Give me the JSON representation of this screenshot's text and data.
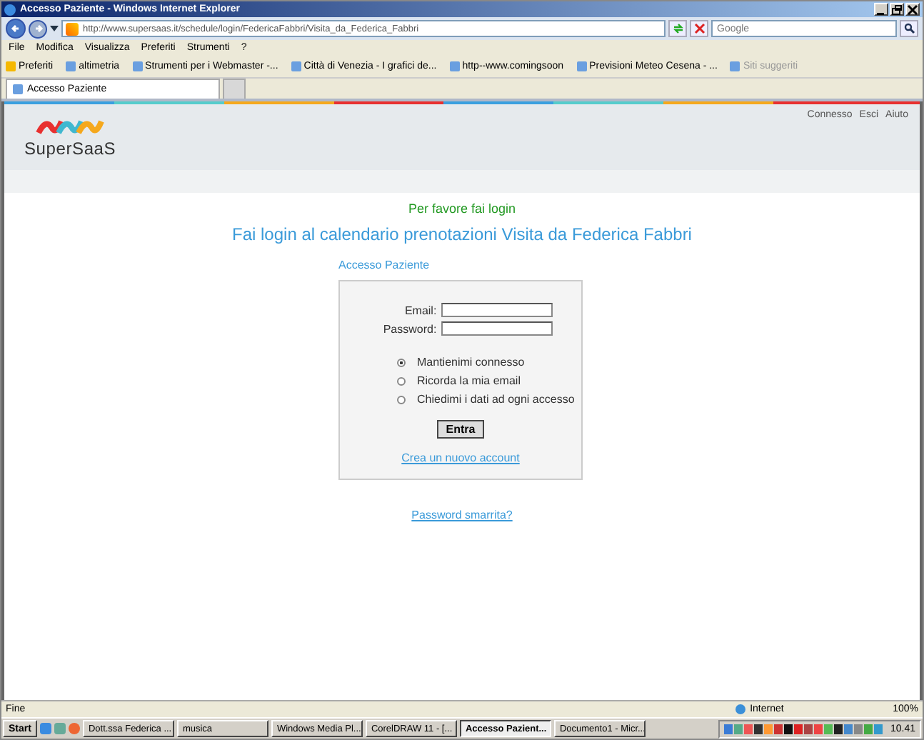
{
  "window": {
    "title": "Accesso Paziente - Windows Internet Explorer"
  },
  "address_bar": {
    "url": "http://www.supersaas.it/schedule/login/FedericaFabbri/Visita_da_Federica_Fabbri"
  },
  "search": {
    "placeholder": "Google"
  },
  "menu": [
    "File",
    "Modifica",
    "Visualizza",
    "Preferiti",
    "Strumenti",
    "?"
  ],
  "favorites": [
    {
      "label": "Preferiti",
      "disabled": false
    },
    {
      "label": "altimetria",
      "disabled": false
    },
    {
      "label": "Strumenti per i Webmaster -...",
      "disabled": false
    },
    {
      "label": "Città di Venezia - I grafici de...",
      "disabled": false
    },
    {
      "label": "http--www.comingsoon",
      "disabled": false
    },
    {
      "label": "Previsioni Meteo Cesena - ...",
      "disabled": false
    },
    {
      "label": "Siti suggeriti",
      "disabled": true
    }
  ],
  "tabs": [
    {
      "label": "Accesso Paziente",
      "selected": true
    },
    {
      "selected": false
    }
  ],
  "page": {
    "logo": "SuperSaaS",
    "nav": [
      "Connesso",
      "Esci",
      "Aiuto"
    ],
    "message": "Per favore fai login",
    "heading": "Fai login al calendario prenotazioni Visita da Federica Fabbri",
    "form_title": "Accesso Paziente",
    "fields": [
      {
        "label": "Email:"
      },
      {
        "label": "Password:"
      }
    ],
    "options": [
      {
        "label": "Mantienimi connesso",
        "selected": true
      },
      {
        "label": "Ricorda la mia email",
        "selected": false
      },
      {
        "label": "Chiedimi i dati ad ogni accesso",
        "selected": false
      }
    ],
    "button": "Entra",
    "create_link": "Crea un nuovo account",
    "forgot_link": "Password smarrita?"
  },
  "status_bar": {
    "text": "Fine",
    "zone": "Internet",
    "zoom": "100%"
  },
  "taskbar": {
    "start": "Start",
    "buttons": [
      {
        "label": "Dott.ssa Federica ...",
        "selected": false
      },
      {
        "label": "musica",
        "selected": false
      },
      {
        "label": "Windows Media Pl...",
        "selected": false
      },
      {
        "label": "CorelDRAW 11 - [...",
        "selected": false
      },
      {
        "label": "Accesso Pazient...",
        "selected": true
      },
      {
        "label": "Documento1 - Micr...",
        "selected": false
      }
    ],
    "clock": "10.41"
  }
}
